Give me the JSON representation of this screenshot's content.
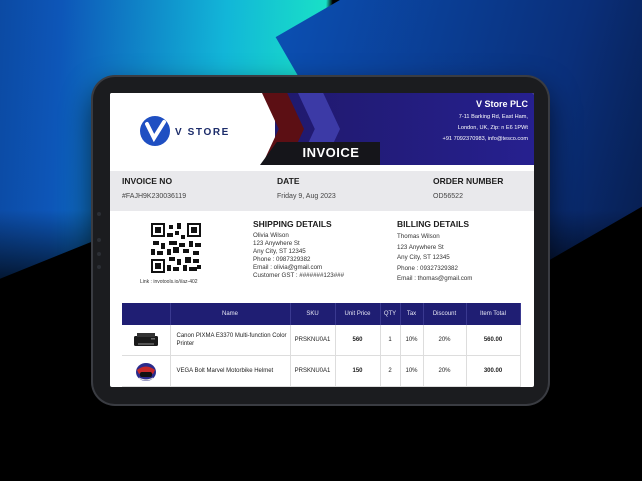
{
  "company": {
    "logo_text": "V STORE",
    "name": "V Store PLC",
    "address1": "7-11 Barking Rd, East Ham,",
    "address2": "London, UK, Zip: n E6 1PWt",
    "contact": "+91 7092370983, info@tesco.com"
  },
  "invoice_title": "INVOICE",
  "meta": {
    "invoice_no_label": "INVOICE NO",
    "invoice_no": "#FAJH9K230036119",
    "date_label": "DATE",
    "date": "Friday 9, Aug 2023",
    "order_label": "ORDER NUMBER",
    "order": "OD56522"
  },
  "qr_caption": "Link : invotools.io/i/az-402",
  "shipping": {
    "title": "SHIPPING DETAILS",
    "lines": [
      "Olivia Wilson",
      "123 Anywhere St",
      "Any City, ST 12345",
      "Phone  : 0987329382",
      "Email : olivia@gmail.com",
      "Customer GST : #######123###"
    ]
  },
  "billing": {
    "title": "BILLING DETAILS",
    "lines": [
      "Thomas Wilson",
      "123 Anywhere St",
      "Any City, ST 12345",
      "Phone  : 09327329382",
      "Email : thomas@gmail.com"
    ]
  },
  "table": {
    "headers": [
      "Name",
      "SKU",
      "Unit Price",
      "QTY",
      "Tax",
      "Discount",
      "Item Total"
    ],
    "rows": [
      {
        "image": "printer-image",
        "name": "Canon PIXMA E3370 Multi-function Color Printer",
        "sku": "PRSKNU0A1",
        "unit_price": "560",
        "qty": "1",
        "tax": "10%",
        "discount": "20%",
        "total": "560.00"
      },
      {
        "image": "helmet-image",
        "name": "VEGA Bolt Marvel Motorbike Helmet",
        "sku": "PRSKNU0A1",
        "unit_price": "150",
        "qty": "2",
        "tax": "10%",
        "discount": "20%",
        "total": "300.00"
      }
    ]
  },
  "colors": {
    "header_blue": "#20196c",
    "accent_maroon": "#5c0f14",
    "table_header": "#1f1e73"
  }
}
